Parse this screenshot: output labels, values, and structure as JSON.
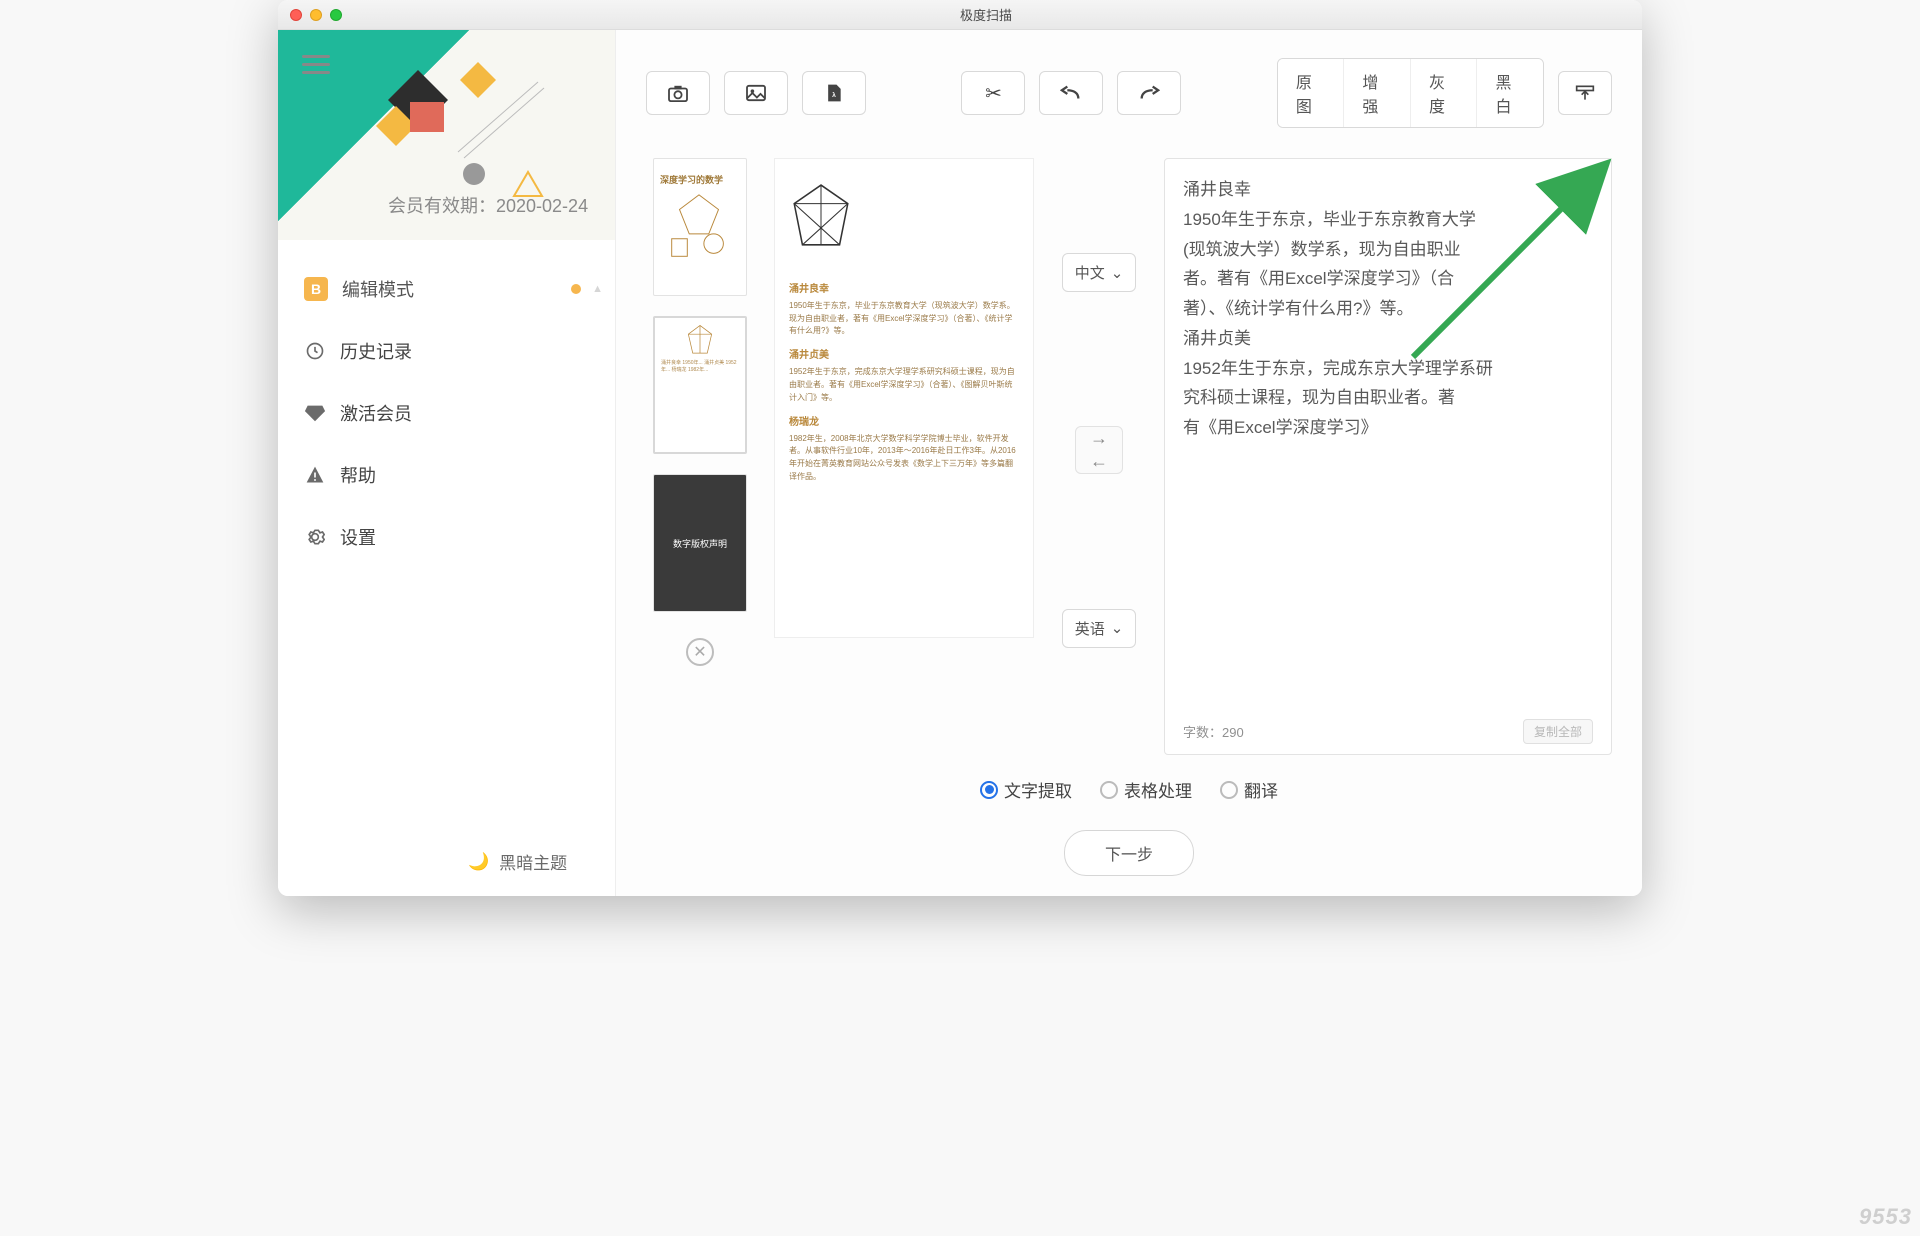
{
  "window_title": "极度扫描",
  "sidebar": {
    "member_prefix": "会员有效期：",
    "member_date": "2020-02-24",
    "items": [
      {
        "label": "编辑模式",
        "badge": "B",
        "active": true
      },
      {
        "label": "历史记录"
      },
      {
        "label": "激活会员"
      },
      {
        "label": "帮助"
      },
      {
        "label": "设置"
      }
    ],
    "dark_mode_label": "黑暗主题"
  },
  "toolbar": {
    "camera": "camera",
    "image": "image",
    "pdf": "pdf",
    "cut": "cut",
    "undo": "undo",
    "redo": "redo",
    "filters": [
      "原图",
      "增强",
      "灰度",
      "黑白"
    ],
    "upload": "upload"
  },
  "thumbs": {
    "t1_title": "深度学习的数学",
    "t3_label": "数字版权声明"
  },
  "preview": {
    "sec1_title": "涌井良幸",
    "sec1_body": "1950年生于东京，毕业于东京教育大学（现筑波大学）数学系。现为自由职业者，著有《用Excel学深度学习》（合著）、《统计学有什么用?》等。",
    "sec2_title": "涌井贞美",
    "sec2_body": "1952年生于东京，完成东京大学理学系研究科硕士课程，现为自由职业者。著有《用Excel学深度学习》（合著）、《图解贝叶斯统计入门》等。",
    "sec3_title": "杨瑞龙",
    "sec3_body": "1982年生，2008年北京大学数学科学学院博士毕业，软件开发者。从事软件行业10年，2013年～2016年赴日工作3年。从2016年开始在菁英教育网站公众号发表《数学上下三万年》等多篇翻译作品。"
  },
  "lang": {
    "from": "中文",
    "to": "英语"
  },
  "ocr": {
    "text": "涌井良幸\n1950年生于东京，毕业于东京教育大学\n(现筑波大学）数学系，现为自由职业\n者。著有《用Excel学深度学习》（合\n著）、《统计学有什么用?》等。\n涌井贞美\n1952年生于东京，完成东京大学理学系研\n究科硕士课程，现为自由职业者。著\n有《用Excel学深度学习》",
    "count_label": "字数：",
    "count_value": "290",
    "copy_label": "复制全部"
  },
  "radios": {
    "text_extract": "文字提取",
    "table_proc": "表格处理",
    "translate": "翻译"
  },
  "next_label": "下一步",
  "watermark": "9553"
}
